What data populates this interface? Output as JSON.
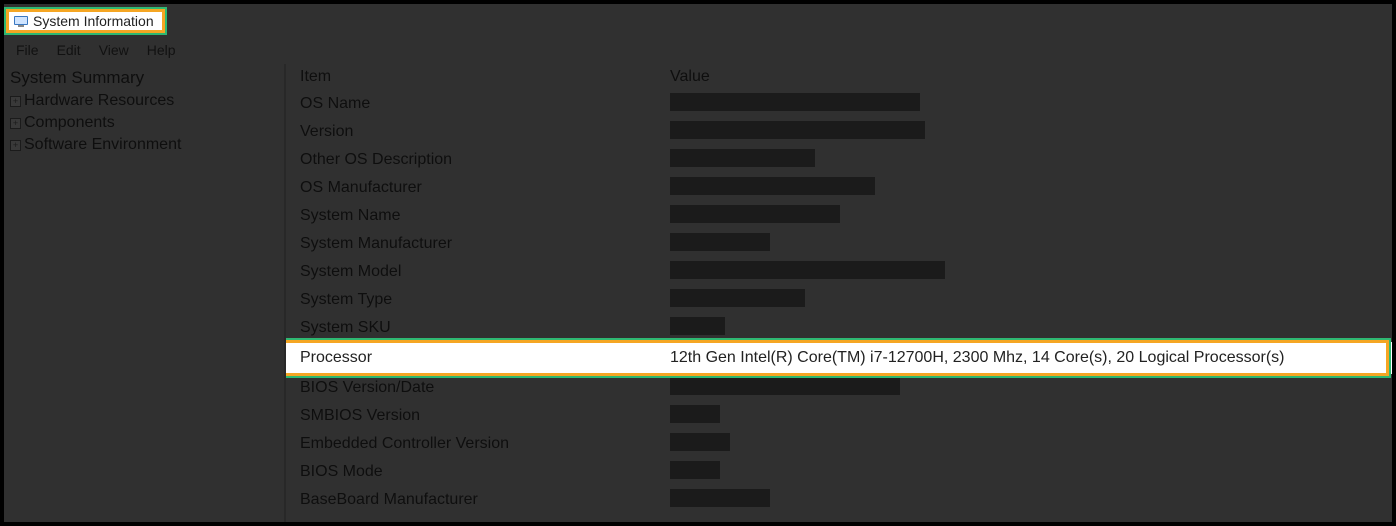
{
  "window": {
    "title": "System Information"
  },
  "menu": {
    "file": "File",
    "edit": "Edit",
    "view": "View",
    "help": "Help"
  },
  "tree": {
    "root": "System Summary",
    "items": [
      {
        "label": "Hardware Resources"
      },
      {
        "label": "Components"
      },
      {
        "label": "Software Environment"
      }
    ]
  },
  "columns": {
    "item": "Item",
    "value": "Value"
  },
  "rows": [
    {
      "item": "OS Name",
      "redacted": true,
      "redact_width": 250,
      "value": ""
    },
    {
      "item": "Version",
      "redacted": true,
      "redact_width": 255,
      "value": ""
    },
    {
      "item": "Other OS Description",
      "redacted": true,
      "redact_width": 145,
      "value": ""
    },
    {
      "item": "OS Manufacturer",
      "redacted": true,
      "redact_width": 205,
      "value": ""
    },
    {
      "item": "System Name",
      "redacted": true,
      "redact_width": 170,
      "value": ""
    },
    {
      "item": "System Manufacturer",
      "redacted": true,
      "redact_width": 100,
      "value": ""
    },
    {
      "item": "System Model",
      "redacted": true,
      "redact_width": 275,
      "value": ""
    },
    {
      "item": "System Type",
      "redacted": true,
      "redact_width": 135,
      "value": ""
    },
    {
      "item": "System SKU",
      "redacted": true,
      "redact_width": 55,
      "value": ""
    },
    {
      "item": "Processor",
      "redacted": false,
      "redact_width": 0,
      "value": "12th Gen Intel(R) Core(TM) i7-12700H, 2300 Mhz, 14 Core(s), 20 Logical Processor(s)",
      "highlight": true
    },
    {
      "item": "BIOS Version/Date",
      "redacted": true,
      "redact_width": 230,
      "value": ""
    },
    {
      "item": "SMBIOS Version",
      "redacted": true,
      "redact_width": 50,
      "value": ""
    },
    {
      "item": "Embedded Controller Version",
      "redacted": true,
      "redact_width": 60,
      "value": ""
    },
    {
      "item": "BIOS Mode",
      "redacted": true,
      "redact_width": 50,
      "value": ""
    },
    {
      "item": "BaseBoard Manufacturer",
      "redacted": true,
      "redact_width": 100,
      "value": ""
    }
  ]
}
